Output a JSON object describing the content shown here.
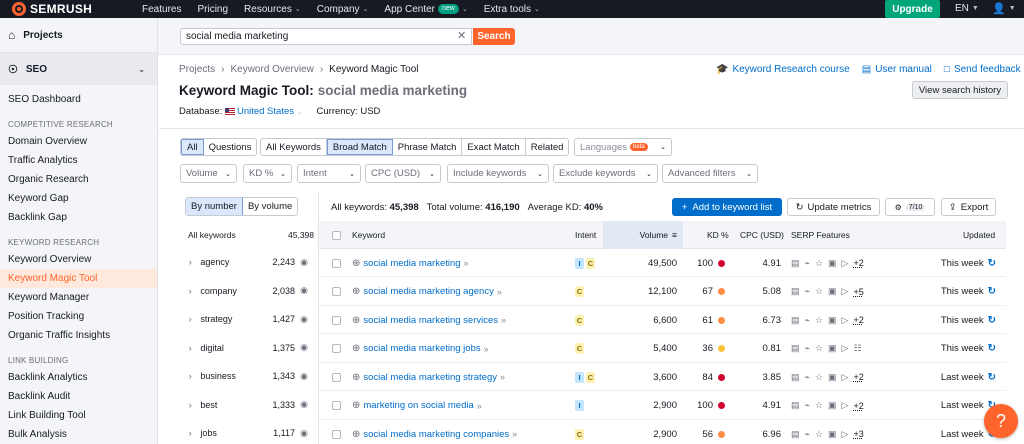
{
  "topbar": {
    "logo": "SEMRUSH",
    "nav": [
      {
        "label": "Features",
        "has_menu": false
      },
      {
        "label": "Pricing",
        "has_menu": false
      },
      {
        "label": "Resources",
        "has_menu": true
      },
      {
        "label": "Company",
        "has_menu": true
      },
      {
        "label": "App Center",
        "has_menu": true,
        "badge": "new"
      },
      {
        "label": "Extra tools",
        "has_menu": true
      }
    ],
    "upgrade": "Upgrade",
    "lang": "EN"
  },
  "sidebar": {
    "projects": "Projects",
    "seo": "SEO",
    "dashboard": "SEO Dashboard",
    "sections": [
      {
        "title": "COMPETITIVE RESEARCH",
        "items": [
          "Domain Overview",
          "Traffic Analytics",
          "Organic Research",
          "Keyword Gap",
          "Backlink Gap"
        ]
      },
      {
        "title": "KEYWORD RESEARCH",
        "items": [
          "Keyword Overview",
          "Keyword Magic Tool",
          "Keyword Manager",
          "Position Tracking",
          "Organic Traffic Insights"
        ]
      },
      {
        "title": "LINK BUILDING",
        "items": [
          "Backlink Analytics",
          "Backlink Audit",
          "Link Building Tool",
          "Bulk Analysis"
        ]
      }
    ],
    "active_item": "Keyword Magic Tool"
  },
  "search": {
    "value": "social media marketing",
    "button": "Search"
  },
  "breadcrumb": [
    "Projects",
    "Keyword Overview",
    "Keyword Magic Tool"
  ],
  "top_links": [
    "Keyword Research course",
    "User manual",
    "Send feedback"
  ],
  "title": {
    "tool": "Keyword Magic Tool:",
    "keyword": "social media marketing"
  },
  "database": {
    "label": "Database:",
    "value": "United States",
    "currency": "Currency: USD"
  },
  "view_history": "View search history",
  "filters": {
    "group1": [
      "All",
      "Questions"
    ],
    "group2": [
      "All Keywords",
      "Broad Match",
      "Phrase Match",
      "Exact Match",
      "Related"
    ],
    "languages": "Languages",
    "languages_badge": "beta",
    "dropdowns": [
      "Volume",
      "KD %",
      "Intent",
      "CPC (USD)",
      "Include keywords",
      "Exclude keywords",
      "Advanced filters"
    ]
  },
  "left_panel": {
    "toggle": [
      "By number",
      "By volume"
    ],
    "header": {
      "label": "All keywords",
      "count": "45,398"
    },
    "groups": [
      {
        "name": "agency",
        "count": "2,243"
      },
      {
        "name": "company",
        "count": "2,038"
      },
      {
        "name": "strategy",
        "count": "1,427"
      },
      {
        "name": "digital",
        "count": "1,375"
      },
      {
        "name": "business",
        "count": "1,343"
      },
      {
        "name": "best",
        "count": "1,333"
      },
      {
        "name": "jobs",
        "count": "1,117"
      }
    ]
  },
  "stats": {
    "all_keywords_label": "All keywords:",
    "all_keywords": "45,398",
    "total_volume_label": "Total volume:",
    "total_volume": "416,190",
    "avg_kd_label": "Average KD:",
    "avg_kd": "40%"
  },
  "actions": {
    "add": "Add to keyword list",
    "update": "Update metrics",
    "config": "7/10",
    "export": "Export"
  },
  "table": {
    "columns": [
      "Keyword",
      "Intent",
      "Volume",
      "KD %",
      "CPC (USD)",
      "SERP Features",
      "Updated"
    ],
    "rows": [
      {
        "keyword": "social media marketing",
        "intent": [
          "I",
          "C"
        ],
        "volume": "49,500",
        "kd": "100",
        "kd_color": "#d1002f",
        "cpc": "4.91",
        "serp_more": "+2",
        "updated": "This week"
      },
      {
        "keyword": "social media marketing agency",
        "intent": [
          "C"
        ],
        "volume": "12,100",
        "kd": "67",
        "kd_color": "#ff8c43",
        "cpc": "5.08",
        "serp_more": "+5",
        "updated": "This week"
      },
      {
        "keyword": "social media marketing services",
        "intent": [
          "C"
        ],
        "volume": "6,600",
        "kd": "61",
        "kd_color": "#ff8c43",
        "cpc": "6.73",
        "serp_more": "+2",
        "updated": "This week"
      },
      {
        "keyword": "social media marketing jobs",
        "intent": [
          "C"
        ],
        "volume": "5,400",
        "kd": "36",
        "kd_color": "#fdc23c",
        "cpc": "0.81",
        "serp_more": "",
        "updated": "This week"
      },
      {
        "keyword": "social media marketing strategy",
        "intent": [
          "I",
          "C"
        ],
        "volume": "3,600",
        "kd": "84",
        "kd_color": "#d1002f",
        "cpc": "3.85",
        "serp_more": "+2",
        "updated": "Last week"
      },
      {
        "keyword": "marketing on social media",
        "intent": [
          "I"
        ],
        "volume": "2,900",
        "kd": "100",
        "kd_color": "#d1002f",
        "cpc": "4.91",
        "serp_more": "+2",
        "updated": "Last week"
      },
      {
        "keyword": "social media marketing companies",
        "intent": [
          "C"
        ],
        "volume": "2,900",
        "kd": "56",
        "kd_color": "#ff8c43",
        "cpc": "6.96",
        "serp_more": "+3",
        "updated": "Last week"
      }
    ]
  },
  "help": "?"
}
